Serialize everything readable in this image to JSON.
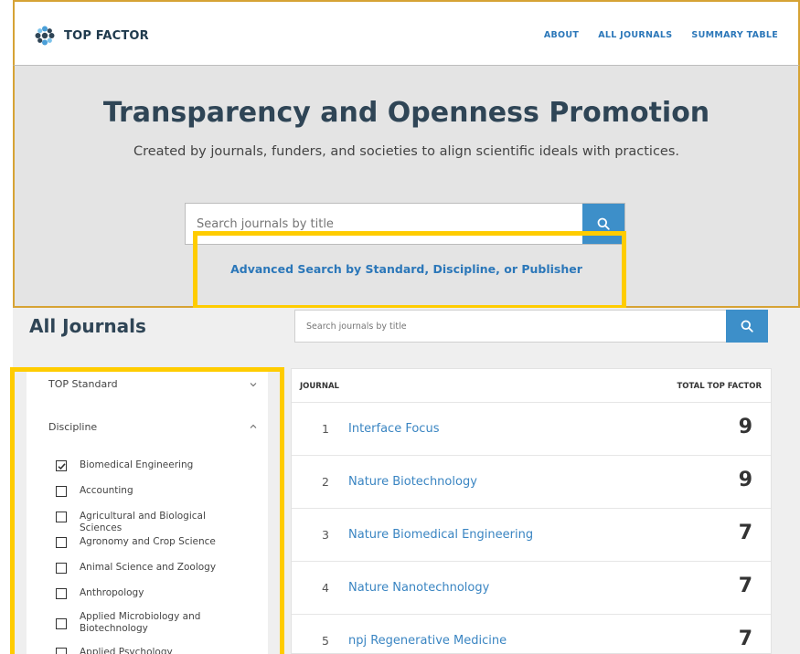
{
  "nav": {
    "brand": "TOP FACTOR",
    "links": [
      "ABOUT",
      "ALL JOURNALS",
      "SUMMARY TABLE"
    ]
  },
  "hero": {
    "title": "Transparency and Openness Promotion",
    "subtitle": "Created by journals, funders, and societies to align scientific ideals with practices.",
    "search_placeholder": "Search journals by title",
    "advanced_link": "Advanced Search by Standard, Discipline, or Publisher"
  },
  "all_journals": {
    "title": "All Journals",
    "search_placeholder": "Search journals by title"
  },
  "sidebar": {
    "top_standard_label": "TOP Standard",
    "discipline_label": "Discipline",
    "disciplines": [
      {
        "label": "Biomedical Engineering",
        "checked": true
      },
      {
        "label": "Accounting",
        "checked": false
      },
      {
        "label": "Agricultural and Biological Sciences",
        "checked": false
      },
      {
        "label": "Agronomy and Crop Science",
        "checked": false
      },
      {
        "label": "Animal Science and Zoology",
        "checked": false
      },
      {
        "label": "Anthropology",
        "checked": false
      },
      {
        "label": "Applied Microbiology and Biotechnology",
        "checked": false
      },
      {
        "label": "Applied Psychology",
        "checked": false
      }
    ]
  },
  "table": {
    "col_journal": "JOURNAL",
    "col_total": "TOTAL TOP FACTOR",
    "rows": [
      {
        "rank": "1",
        "name": "Interface Focus",
        "score": "9"
      },
      {
        "rank": "2",
        "name": "Nature Biotechnology",
        "score": "9"
      },
      {
        "rank": "3",
        "name": "Nature Biomedical Engineering",
        "score": "7"
      },
      {
        "rank": "4",
        "name": "Nature Nanotechnology",
        "score": "7"
      },
      {
        "rank": "5",
        "name": "npj Regenerative Medicine",
        "score": "7"
      }
    ]
  },
  "colors": {
    "accent": "#2b77b9",
    "button": "#3d8fc9",
    "highlight": "#ffcc00",
    "frame_border": "#d6a335"
  }
}
